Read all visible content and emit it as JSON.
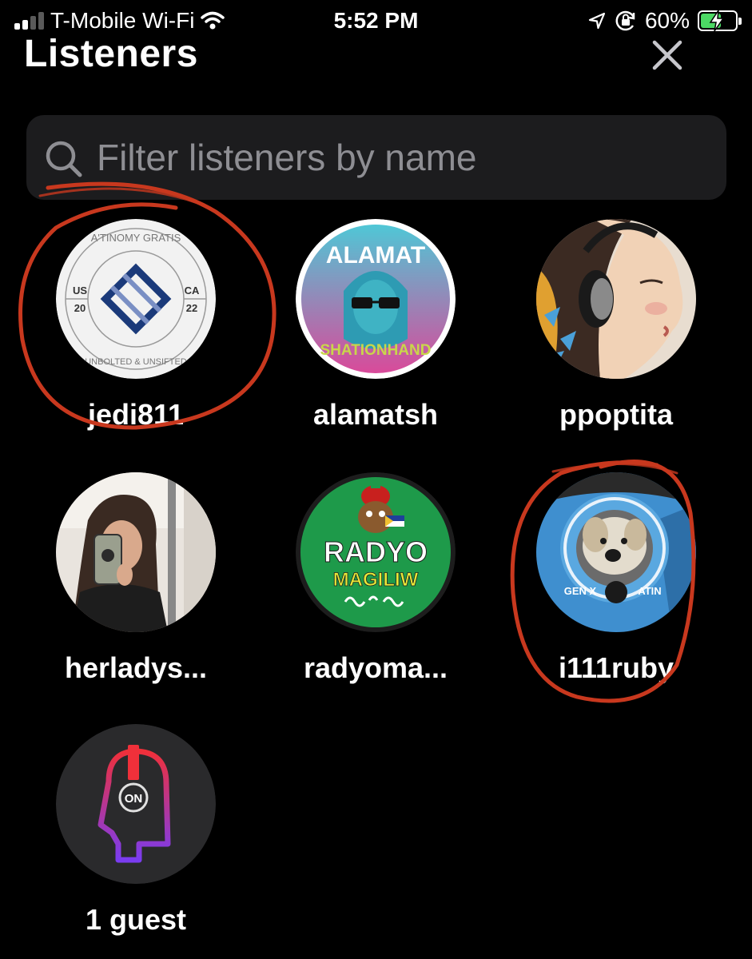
{
  "status_bar": {
    "carrier": "T-Mobile Wi-Fi",
    "time": "5:52 PM",
    "battery_percent": "60%",
    "battery_level": 0.6,
    "battery_color": "#4cd964",
    "icons": [
      "cellular-signal-icon",
      "wifi-icon",
      "location-arrow-icon",
      "orientation-lock-icon",
      "battery-charging-icon"
    ]
  },
  "header": {
    "title": "Listeners",
    "close_icon": "close-icon"
  },
  "search": {
    "placeholder": "Filter listeners by name",
    "value": "",
    "icon": "search-icon"
  },
  "listeners": [
    {
      "name": "jedi811",
      "avatar_icon": "emblem-avatar",
      "avatar_text": {
        "top": "A'TINOMY GRATIS",
        "bottom": "UNBOLTED & UNSIFTED",
        "left": "US",
        "right": "CA",
        "left_num": "20",
        "right_num": "22"
      }
    },
    {
      "name": "alamatsh",
      "avatar_icon": "alamat-logo-avatar",
      "avatar_text": {
        "top": "ALAMAT",
        "bottom": "SHATIONHAND"
      }
    },
    {
      "name": "ppoptita",
      "avatar_icon": "illustrated-woman-headphones-avatar"
    },
    {
      "name": "herladys...",
      "avatar_icon": "selfie-photo-avatar"
    },
    {
      "name": "radyoma...",
      "avatar_icon": "radyo-magiliw-logo-avatar",
      "avatar_text": {
        "line1": "RADYO",
        "line2": "MAGILIW"
      }
    },
    {
      "name": "i111ruby",
      "avatar_icon": "dog-badge-avatar",
      "avatar_text": {
        "left": "GEN X",
        "right": "ATIN"
      }
    },
    {
      "name": "1 guest",
      "avatar_icon": "guest-head-headphones-icon",
      "avatar_text": {
        "badge": "ON"
      }
    }
  ],
  "annotations": {
    "color": "#c8381e",
    "circled_listeners": [
      "jedi811",
      "i111ruby"
    ]
  }
}
